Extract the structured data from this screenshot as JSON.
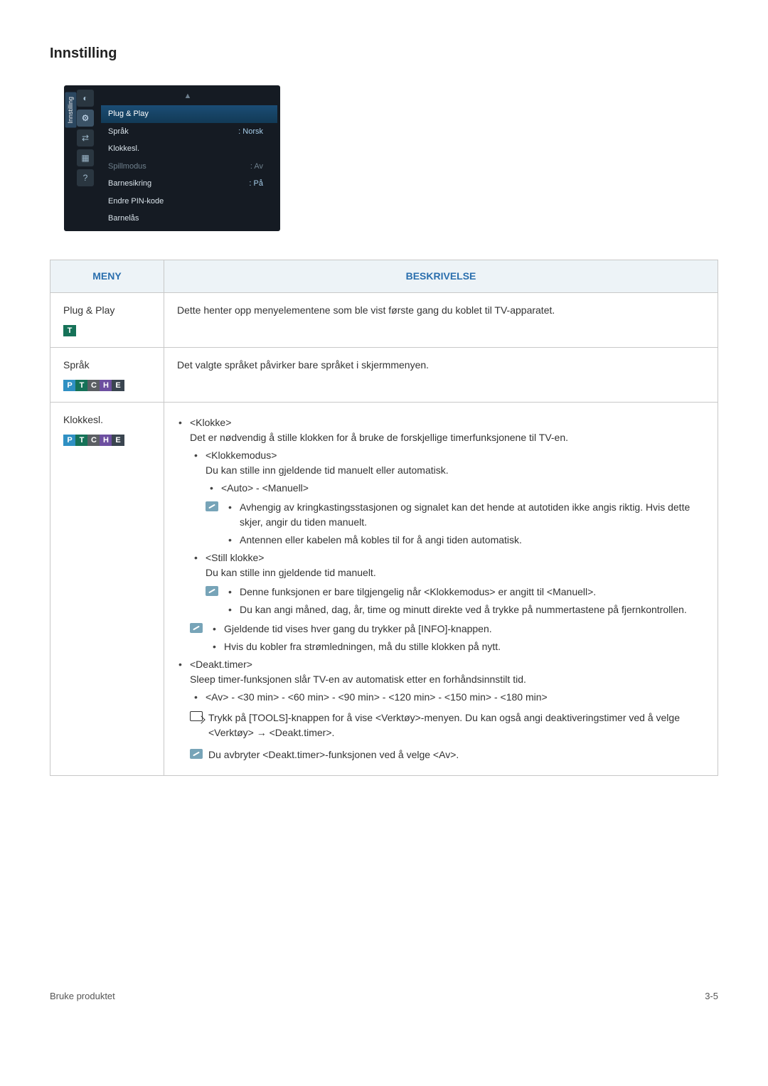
{
  "page_title": "Innstilling",
  "osd": {
    "side_tab": "Innstilling",
    "top_dots": "▲",
    "rows": [
      {
        "label": "Plug & Play",
        "value": "",
        "class": "hl"
      },
      {
        "label": "Språk",
        "value": ": Norsk",
        "class": ""
      },
      {
        "label": "Klokkesl.",
        "value": "",
        "class": ""
      },
      {
        "label": "Spillmodus",
        "value": ": Av",
        "class": "dim"
      },
      {
        "label": "Barnesikring",
        "value": ": På",
        "class": ""
      },
      {
        "label": "Endre PIN-kode",
        "value": "",
        "class": ""
      },
      {
        "label": "Barnelås",
        "value": "",
        "class": ""
      }
    ]
  },
  "table": {
    "header_menu": "MENY",
    "header_desc": "BESKRIVELSE",
    "rows": [
      {
        "menu_name": "Plug & Play",
        "badges": [
          "T"
        ],
        "desc_html_id": "d1"
      },
      {
        "menu_name": "Språk",
        "badges": [
          "P",
          "T",
          "C",
          "H",
          "E"
        ],
        "desc_html_id": "d2"
      },
      {
        "menu_name": "Klokkesl.",
        "badges": [
          "P",
          "T",
          "C",
          "H",
          "E"
        ],
        "desc_html_id": "d3"
      }
    ]
  },
  "desc": {
    "d1": "Dette henter opp menyelementene som ble vist første gang du koblet til TV-apparatet.",
    "d2": "Det valgte språket påvirker bare språket i skjermmenyen.",
    "d3_klokke": "<Klokke>",
    "d3_klokke_intro": "Det er nødvendig å stille klokken for å bruke de forskjellige timerfunksjonene til TV-en.",
    "d3_klokkemodus": "<Klokkemodus>",
    "d3_klokkemodus_text": "Du kan stille inn gjeldende tid manuelt eller automatisk.",
    "d3_auto_man": "<Auto> - <Manuell>",
    "d3_note1_a": "Avhengig av kringkastingsstasjonen og signalet kan det hende at autotiden ikke angis riktig. Hvis dette skjer, angir du tiden manuelt.",
    "d3_note1_b": "Antennen eller kabelen må kobles til for å angi tiden automatisk.",
    "d3_stillklokke": "<Still klokke>",
    "d3_stillklokke_text": "Du kan stille inn gjeldende tid manuelt.",
    "d3_note2_a": "Denne funksjonen er bare tilgjengelig når <Klokkemodus> er angitt til <Manuell>.",
    "d3_note2_b": "Du kan angi måned, dag, år, time og minutt direkte ved å trykke på nummertastene på fjernkontrollen.",
    "d3_note3_a": "Gjeldende tid vises hver gang du trykker på [INFO]-knappen.",
    "d3_note3_b": "Hvis du kobler fra strømledningen, må du stille klokken på nytt.",
    "d3_deakt": "<Deakt.timer>",
    "d3_deakt_text1": "Sleep timer-funksjonen slår TV-en av automatisk etter en forhåndsinnstilt tid.",
    "d3_deakt_opts": "<Av> - <30 min> - <60 min> - <90 min> - <120 min> - <150 min> - <180 min>",
    "d3_tools": "Trykk på [TOOLS]-knappen for å vise <Verktøy>-menyen. Du kan også angi deaktiveringstimer ved å velge <Verktøy> → <Deakt.timer>.",
    "d3_note4": "Du avbryter <Deakt.timer>-funksjonen ved å velge <Av>."
  },
  "footer_left": "Bruke produktet",
  "footer_right": "3-5"
}
